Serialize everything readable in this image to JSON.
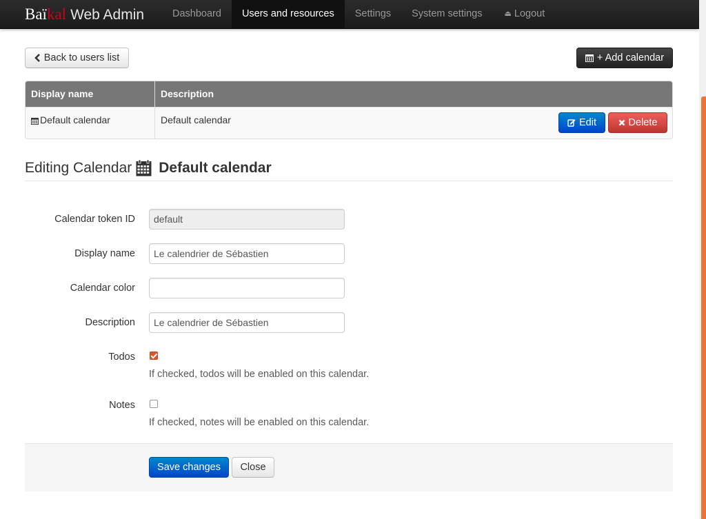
{
  "brand": {
    "part1": "Baï",
    "part2": "kal",
    "part3": "Web Admin"
  },
  "nav": [
    {
      "label": "Dashboard"
    },
    {
      "label": "Users and resources"
    },
    {
      "label": "Settings"
    },
    {
      "label": "System settings"
    },
    {
      "label": "Logout"
    }
  ],
  "toolbar": {
    "back_label": "Back to users list",
    "add_label": "+ Add calendar"
  },
  "table": {
    "headers": [
      "Display name",
      "Description"
    ],
    "rows": [
      {
        "display_name": "Default calendar",
        "description": "Default calendar",
        "edit_label": "Edit",
        "delete_label": "Delete"
      }
    ]
  },
  "editing": {
    "prefix": "Editing Calendar",
    "name": "Default calendar"
  },
  "form": {
    "token": {
      "label": "Calendar token ID",
      "value": "default"
    },
    "display_name": {
      "label": "Display name",
      "value": "Le calendrier de Sébastien"
    },
    "color": {
      "label": "Calendar color",
      "value": ""
    },
    "description": {
      "label": "Description",
      "value": "Le calendrier de Sébastien"
    },
    "todos": {
      "label": "Todos",
      "checked": true,
      "help": "If checked, todos will be enabled on this calendar."
    },
    "notes": {
      "label": "Notes",
      "checked": false,
      "help": "If checked, notes will be enabled on this calendar."
    },
    "save_label": "Save changes",
    "close_label": "Close"
  },
  "colors": {
    "accent": "#d9582b",
    "primary": "#0074cc",
    "danger": "#da4f49",
    "navbar": "#222222"
  },
  "icons": [
    "chevron-left-icon",
    "calendar-icon",
    "edit-icon",
    "remove-icon",
    "eject-icon"
  ]
}
